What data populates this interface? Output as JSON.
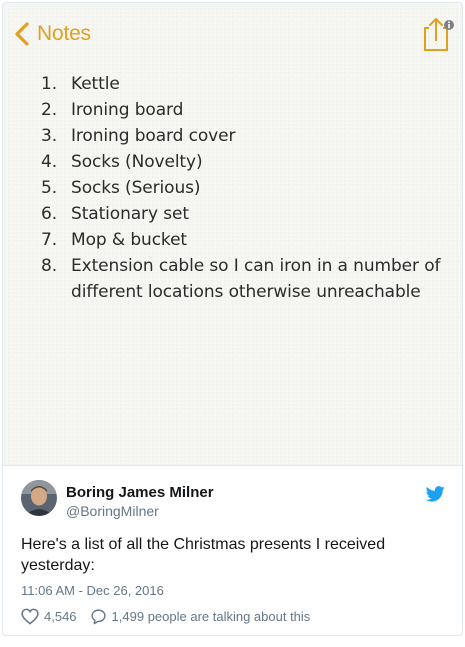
{
  "notes": {
    "back_label": "Notes",
    "items": [
      {
        "num": "1.",
        "text": "Kettle"
      },
      {
        "num": "2.",
        "text": "Ironing board"
      },
      {
        "num": "3.",
        "text": "Ironing board cover"
      },
      {
        "num": "4.",
        "text": "Socks (Novelty)"
      },
      {
        "num": "5.",
        "text": "Socks (Serious)"
      },
      {
        "num": "6.",
        "text": "Stationary set"
      },
      {
        "num": "7.",
        "text": "Mop & bucket"
      },
      {
        "num": "8.",
        "text": "Extension cable so I can iron in a number of different locations otherwise unreachable"
      }
    ],
    "accent": "#e0a020"
  },
  "tweet": {
    "name": "Boring James Milner",
    "handle": "@BoringMilner",
    "text": "Here's a list of all the Christmas presents I received yesterday:",
    "timestamp": "11:06 AM - Dec 26, 2016",
    "likes": "4,546",
    "talking": "1,499 people are talking about this",
    "brand_color": "#1da1f2"
  },
  "icons": {
    "back": "chevron-left-icon",
    "share": "share-icon",
    "info": "info-icon",
    "bird": "twitter-bird-icon",
    "like": "heart-icon",
    "reply": "reply-icon"
  }
}
